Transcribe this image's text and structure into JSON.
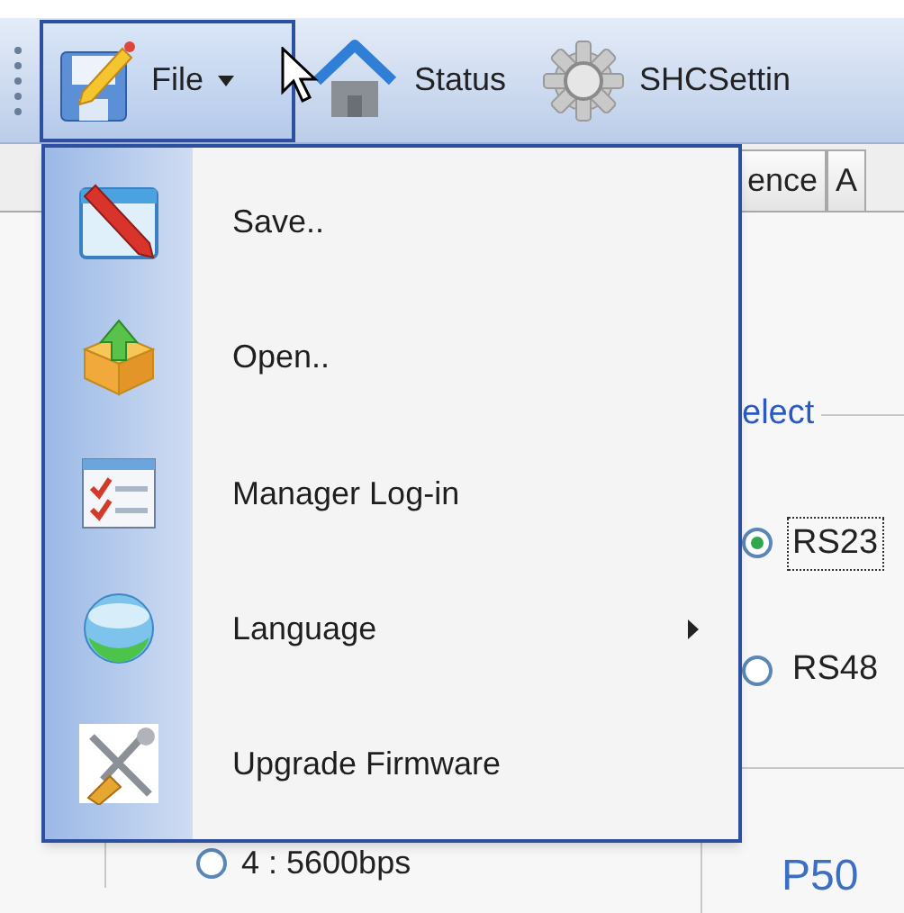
{
  "toolbar": {
    "items": [
      {
        "label": "File",
        "selected": true,
        "has_dropdown": true
      },
      {
        "label": "Status",
        "selected": false,
        "has_dropdown": false
      },
      {
        "label": "SHCSettin",
        "selected": false,
        "has_dropdown": false
      }
    ]
  },
  "tabs": [
    {
      "label": "ence",
      "selected": false
    },
    {
      "label": "A",
      "selected": false
    }
  ],
  "background": {
    "group_title": "elect",
    "radios": [
      {
        "label": "RS23",
        "selected": true
      },
      {
        "label": "RS48",
        "selected": false
      }
    ],
    "baud_radio": {
      "label": "4 : 5600bps",
      "selected": false
    },
    "panel_label": "P50"
  },
  "file_menu": {
    "items": [
      {
        "label": "Save..",
        "has_submenu": false
      },
      {
        "label": "Open..",
        "has_submenu": false
      },
      {
        "label": "Manager Log-in",
        "has_submenu": false
      },
      {
        "label": "Language",
        "has_submenu": true
      },
      {
        "label": "Upgrade Firmware",
        "has_submenu": false
      }
    ]
  }
}
